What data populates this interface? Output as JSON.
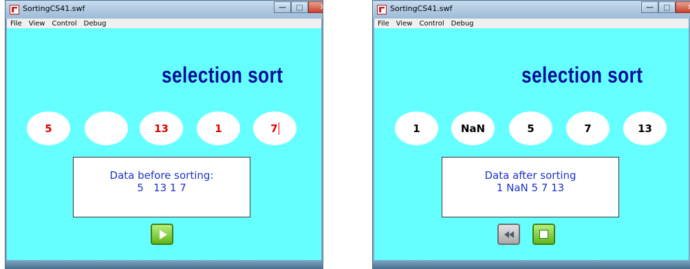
{
  "left_window": {
    "title": "SortingCS41.swf",
    "menu": [
      "File",
      "View",
      "Control",
      "Debug"
    ],
    "heading": "selection sort",
    "circles": [
      "5",
      "",
      "13",
      "1",
      "7"
    ],
    "box_line1": "Data before  sorting:",
    "box_line2": "5   13 1 7",
    "buttons": [
      {
        "name": "play-icon"
      }
    ]
  },
  "right_window": {
    "title": "SortingCS41.swf",
    "menu": [
      "File",
      "View",
      "Control",
      "Debug"
    ],
    "heading": "selection sort",
    "circles": [
      "1",
      "NaN",
      "5",
      "7",
      "13"
    ],
    "box_line1": "Data after sorting",
    "box_line2": "1 NaN 5 7 13",
    "buttons": [
      {
        "name": "rewind-icon"
      },
      {
        "name": "stop-icon"
      }
    ]
  },
  "window_controls": {
    "minimize": "—",
    "maximize": "□",
    "close": "✕"
  },
  "colors": {
    "stage": "#66ffff",
    "heading": "#000d99",
    "left_numbers": "#e00000",
    "right_numbers": "#000000",
    "box_text": "#1b33c9",
    "green_button": "#60b51c"
  }
}
